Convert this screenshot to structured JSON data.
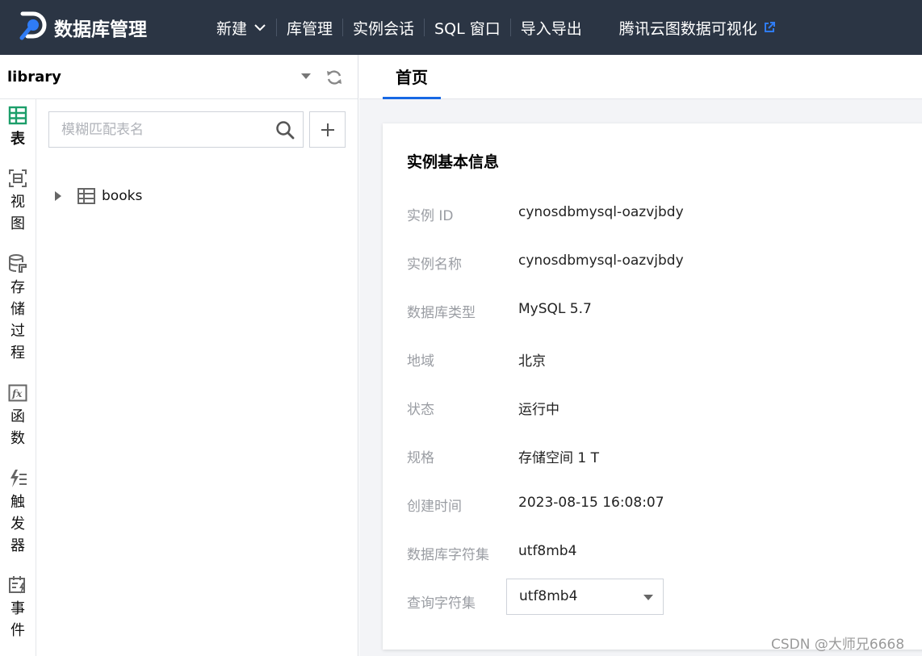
{
  "app": {
    "title": "数据库管理"
  },
  "nav": {
    "items": [
      {
        "label": "新建",
        "has_dropdown": true
      },
      {
        "label": "库管理"
      },
      {
        "label": "实例会话"
      },
      {
        "label": "SQL 窗口"
      },
      {
        "label": "导入导出"
      }
    ],
    "external": {
      "label": "腾讯云图数据可视化",
      "icon": "external-link-icon"
    }
  },
  "sidebar": {
    "database": "library",
    "tabs": [
      {
        "label": "表",
        "icon": "table-icon",
        "active": true
      },
      {
        "label": "视图",
        "icon": "view-icon"
      },
      {
        "label": "存储过程",
        "icon": "stored-procedure-icon"
      },
      {
        "label": "函数",
        "icon": "function-icon"
      },
      {
        "label": "触发器",
        "icon": "trigger-icon"
      },
      {
        "label": "事件",
        "icon": "event-icon"
      }
    ],
    "search": {
      "placeholder": "模糊匹配表名",
      "value": ""
    },
    "tables": [
      {
        "name": "books"
      }
    ]
  },
  "main": {
    "tabs": [
      {
        "label": "首页",
        "active": true
      }
    ],
    "card": {
      "title": "实例基本信息",
      "rows": [
        {
          "label": "实例 ID",
          "value": "cynosdbmysql-oazvjbdy"
        },
        {
          "label": "实例名称",
          "value": "cynosdbmysql-oazvjbdy"
        },
        {
          "label": "数据库类型",
          "value": "MySQL 5.7"
        },
        {
          "label": "地域",
          "value": "北京"
        },
        {
          "label": "状态",
          "value": "运行中"
        },
        {
          "label": "规格",
          "value": "存储空间 1 T"
        },
        {
          "label": "创建时间",
          "value": "2023-08-15 16:08:07"
        },
        {
          "label": "数据库字符集",
          "value": "utf8mb4"
        }
      ],
      "query_charset": {
        "label": "查询字符集",
        "value": "utf8mb4"
      }
    }
  },
  "watermark": "CSDN @大师兄6668",
  "colors": {
    "topbar": "#2b3544",
    "accent": "#1768e4",
    "logo": "#2f7cf6",
    "table_icon": "#1c9e6a"
  }
}
